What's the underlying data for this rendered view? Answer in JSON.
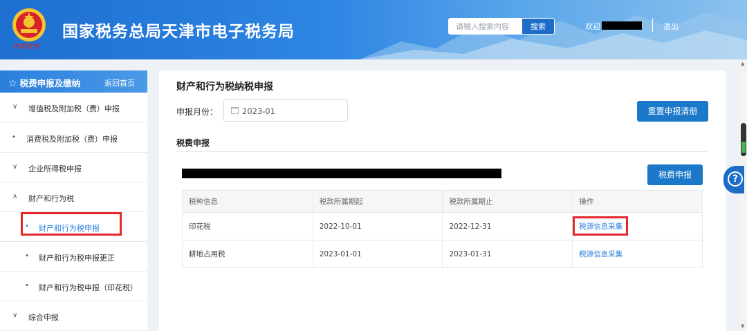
{
  "header": {
    "title": "国家税务总局天津市电子税务局",
    "emblem_text": "中国税务",
    "search": {
      "placeholder": "请输入搜索内容",
      "button": "搜索"
    },
    "welcome": "欢迎",
    "logout": "退出"
  },
  "sidebar": {
    "title": "税费申报及缴纳",
    "home_link": "返回首页",
    "items": [
      {
        "mark": "∨",
        "label": "增值税及附加税（费）申报"
      },
      {
        "mark": "•",
        "label": "消费税及附加税（费）申报"
      },
      {
        "mark": "∨",
        "label": "企业所得税申报"
      },
      {
        "mark": "∧",
        "label": "财产和行为税"
      },
      {
        "mark": "•",
        "label": "财产和行为税申报",
        "active": true
      },
      {
        "mark": "•",
        "label": "财产和行为税申报更正"
      },
      {
        "mark": "•",
        "label": "财产和行为税申报（印花税）"
      },
      {
        "mark": "∨",
        "label": "综合申报"
      }
    ]
  },
  "main": {
    "title": "财产和行为税纳税申报",
    "month_label": "申报月份：",
    "month_value": "2023-01",
    "reset_button": "重置申报清册",
    "section_title": "税费申报",
    "declare_button": "税费申报",
    "table": {
      "headers": [
        "税种信息",
        "税款所属期起",
        "税款所属期止",
        "操作"
      ],
      "rows": [
        [
          "印花税",
          "2022-10-01",
          "2022-12-31",
          "税源信息采集"
        ],
        [
          "耕地占用税",
          "2023-01-01",
          "2023-01-31",
          "税源信息采集"
        ]
      ]
    }
  },
  "colors": {
    "primary": "#1c78c8",
    "highlight": "#e5262b",
    "link": "#2b7fdc"
  }
}
